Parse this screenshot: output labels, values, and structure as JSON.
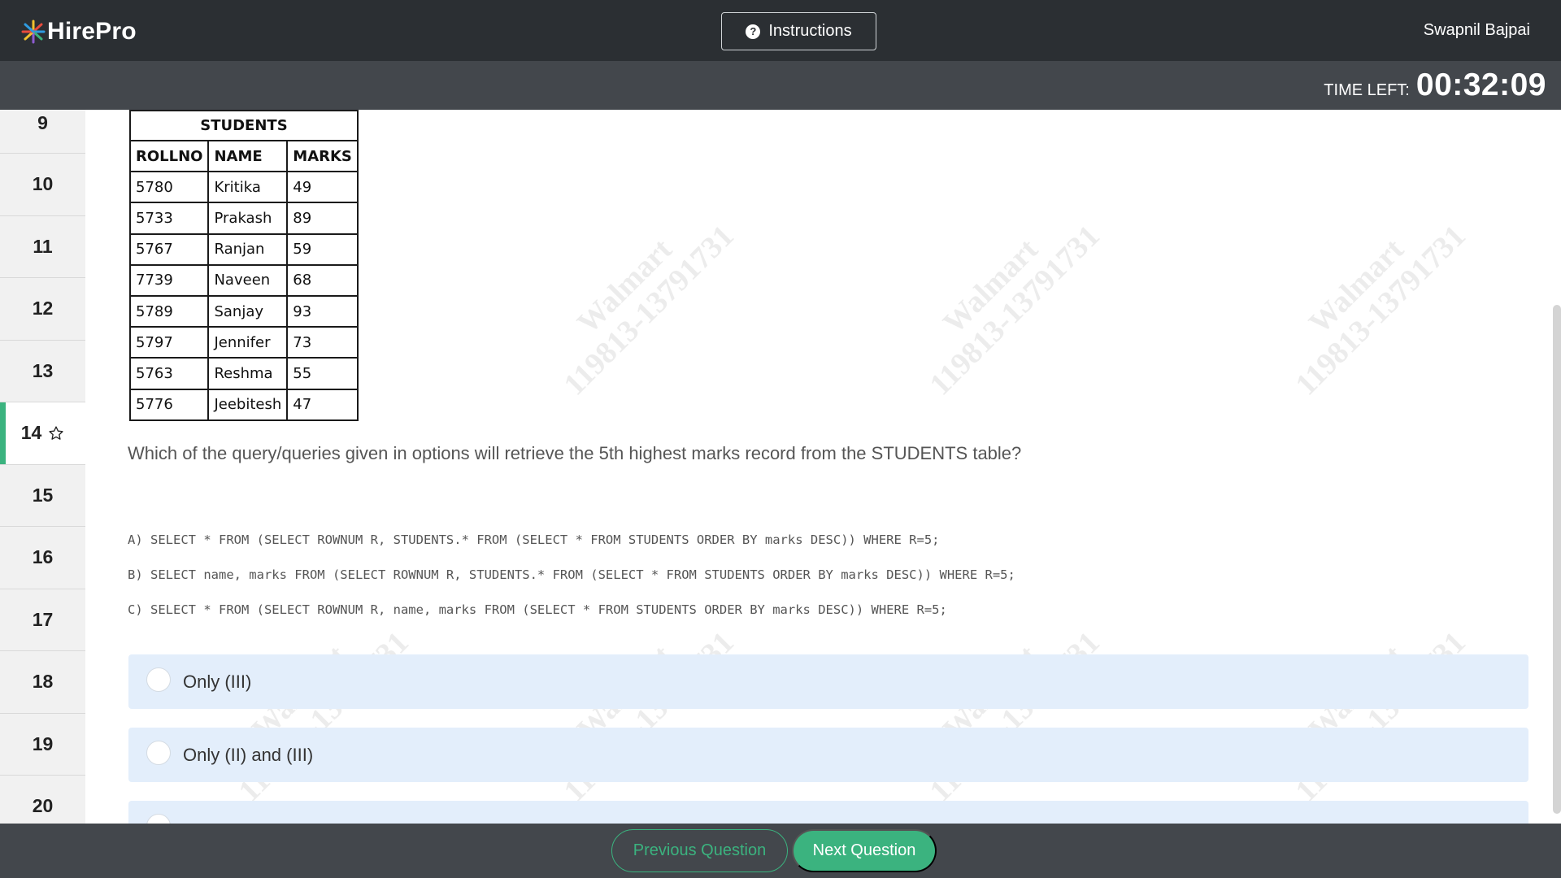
{
  "app": {
    "logo_text": "HirePro"
  },
  "header": {
    "instructions_label": "Instructions",
    "user_name": "Swapnil Bajpai"
  },
  "timer": {
    "label": "TIME LEFT:",
    "value": "00:32:09"
  },
  "sidebar": {
    "questions": [
      "9",
      "10",
      "11",
      "12",
      "13",
      "14",
      "15",
      "16",
      "17",
      "18",
      "19",
      "20"
    ],
    "active": "14"
  },
  "watermark": {
    "line1": "Walmart",
    "line2": "119813-13791731"
  },
  "table": {
    "caption": "STUDENTS",
    "headers": [
      "ROLLNO",
      "NAME",
      "MARKS"
    ],
    "rows": [
      [
        "5780",
        "Kritika",
        "49"
      ],
      [
        "5733",
        "Prakash",
        "89"
      ],
      [
        "5767",
        "Ranjan",
        "59"
      ],
      [
        "7739",
        "Naveen",
        "68"
      ],
      [
        "5789",
        "Sanjay",
        "93"
      ],
      [
        "5797",
        "Jennifer",
        "73"
      ],
      [
        "5763",
        "Reshma",
        "55"
      ],
      [
        "5776",
        "Jeebitesh",
        "47"
      ]
    ]
  },
  "question": {
    "text": "Which of the query/queries given in options will retrieve the 5th highest marks record from the STUDENTS table?",
    "code_a": "A) SELECT * FROM (SELECT ROWNUM R, STUDENTS.* FROM (SELECT * FROM STUDENTS ORDER BY marks DESC)) WHERE R=5;",
    "code_b": "B) SELECT name, marks FROM (SELECT ROWNUM R, STUDENTS.* FROM (SELECT * FROM STUDENTS ORDER BY marks DESC)) WHERE R=5;",
    "code_c": "C) SELECT * FROM (SELECT ROWNUM R, name, marks FROM (SELECT * FROM STUDENTS ORDER BY marks DESC)) WHERE R=5;"
  },
  "options": [
    "Only (III)",
    "Only (II) and (III)"
  ],
  "footer": {
    "previous_label": "Previous Question",
    "next_label": "Next Question"
  },
  "colors": {
    "accent": "#3bb37f",
    "topbar": "#2b2f33",
    "subbar": "#43474c",
    "option_bg": "#e3eefb"
  }
}
